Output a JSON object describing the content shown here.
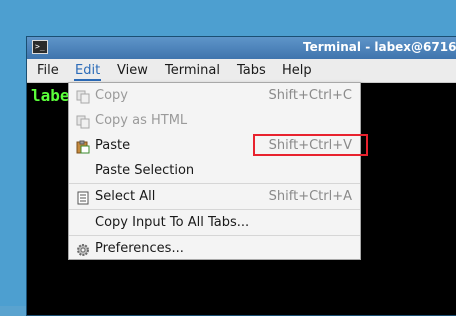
{
  "window": {
    "title": "Terminal - labex@6716"
  },
  "menubar": {
    "items": [
      "File",
      "Edit",
      "View",
      "Terminal",
      "Tabs",
      "Help"
    ],
    "active": "Edit"
  },
  "terminal": {
    "prompt": "labe"
  },
  "edit_menu": {
    "items": [
      {
        "label": "Copy",
        "shortcut": "Shift+Ctrl+C",
        "enabled": false,
        "icon": "copy-icon"
      },
      {
        "label": "Copy as HTML",
        "shortcut": "",
        "enabled": false,
        "icon": "copy-icon"
      },
      {
        "label": "Paste",
        "shortcut": "Shift+Ctrl+V",
        "enabled": true,
        "icon": "paste-icon"
      },
      {
        "label": "Paste Selection",
        "shortcut": "",
        "enabled": true,
        "icon": ""
      },
      {
        "label": "Select All",
        "shortcut": "Shift+Ctrl+A",
        "enabled": true,
        "icon": "select-all-icon"
      },
      {
        "label": "Copy Input To All Tabs...",
        "shortcut": "",
        "enabled": true,
        "icon": ""
      },
      {
        "label": "Preferences...",
        "shortcut": "",
        "enabled": true,
        "icon": "gear-icon"
      }
    ]
  },
  "colors": {
    "highlight": "#e8222e",
    "active_menu": "#2b6bb8",
    "prompt": "#5bff3a"
  }
}
